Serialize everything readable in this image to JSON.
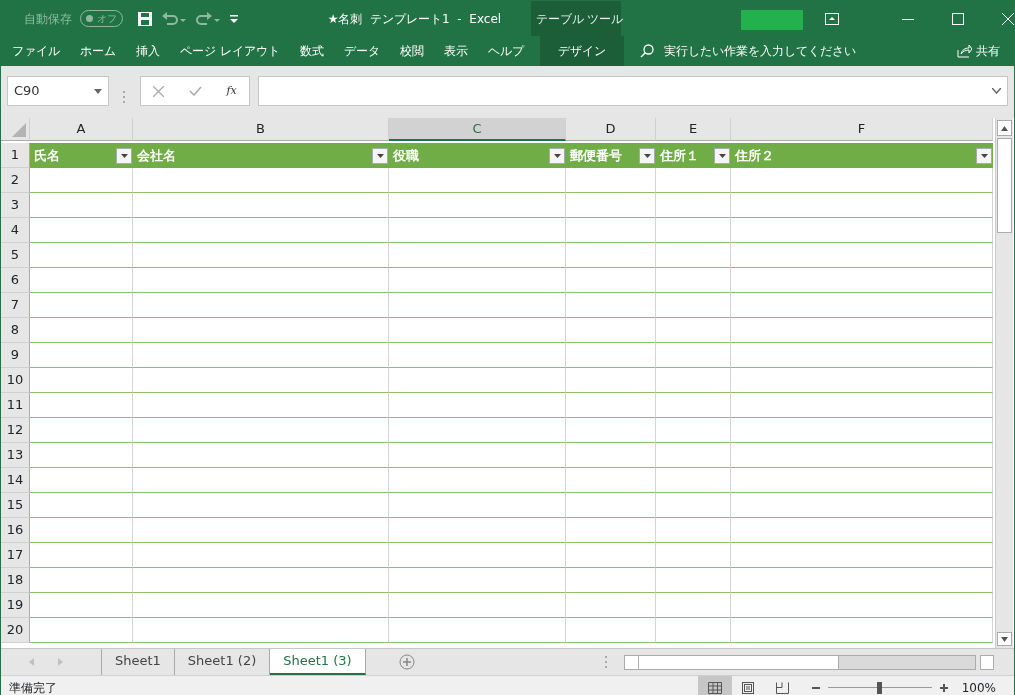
{
  "title_bar": {
    "autosave_label": "自動保存",
    "autosave_toggle": {
      "label": "オフ",
      "on": false
    },
    "title": "★名刺  テンプレート1  -  Excel",
    "context_label": "テーブル ツール"
  },
  "ribbon_tabs": [
    {
      "label": "ファイル",
      "contextual": false
    },
    {
      "label": "ホーム",
      "contextual": false
    },
    {
      "label": "挿入",
      "contextual": false
    },
    {
      "label": "ページ レイアウト",
      "contextual": false
    },
    {
      "label": "数式",
      "contextual": false
    },
    {
      "label": "データ",
      "contextual": false
    },
    {
      "label": "校閲",
      "contextual": false
    },
    {
      "label": "表示",
      "contextual": false
    },
    {
      "label": "ヘルプ",
      "contextual": false
    },
    {
      "label": "デザイン",
      "contextual": true
    }
  ],
  "tell_me": {
    "placeholder": "実行したい作業を入力してください"
  },
  "share": "共有",
  "formula_bar": {
    "name_box": "C90",
    "fx": "fx"
  },
  "columns": [
    {
      "letter": "A",
      "selected": false
    },
    {
      "letter": "B",
      "selected": false
    },
    {
      "letter": "C",
      "selected": true
    },
    {
      "letter": "D",
      "selected": false
    },
    {
      "letter": "E",
      "selected": false
    },
    {
      "letter": "F",
      "selected": false
    }
  ],
  "table_header": [
    "氏名",
    "会社名",
    "役職",
    "郵便番号",
    "住所１",
    "住所２"
  ],
  "row_numbers": [
    "1",
    "2",
    "3",
    "4",
    "5",
    "6",
    "7",
    "8",
    "9",
    "10",
    "11",
    "12",
    "13",
    "14",
    "15",
    "16",
    "17",
    "18",
    "19",
    "20"
  ],
  "sheet_tabs": [
    {
      "label": "Sheet1",
      "selected": false
    },
    {
      "label": "Sheet1 (2)",
      "selected": false
    },
    {
      "label": "Sheet1 (3)",
      "selected": true
    }
  ],
  "status_bar": {
    "status": "準備完了",
    "views": [
      {
        "kind": "normal",
        "selected": true
      },
      {
        "kind": "layout",
        "selected": false
      },
      {
        "kind": "pagebreak",
        "selected": false
      }
    ],
    "zoom": {
      "level": 0.5,
      "reading": "100%"
    }
  }
}
